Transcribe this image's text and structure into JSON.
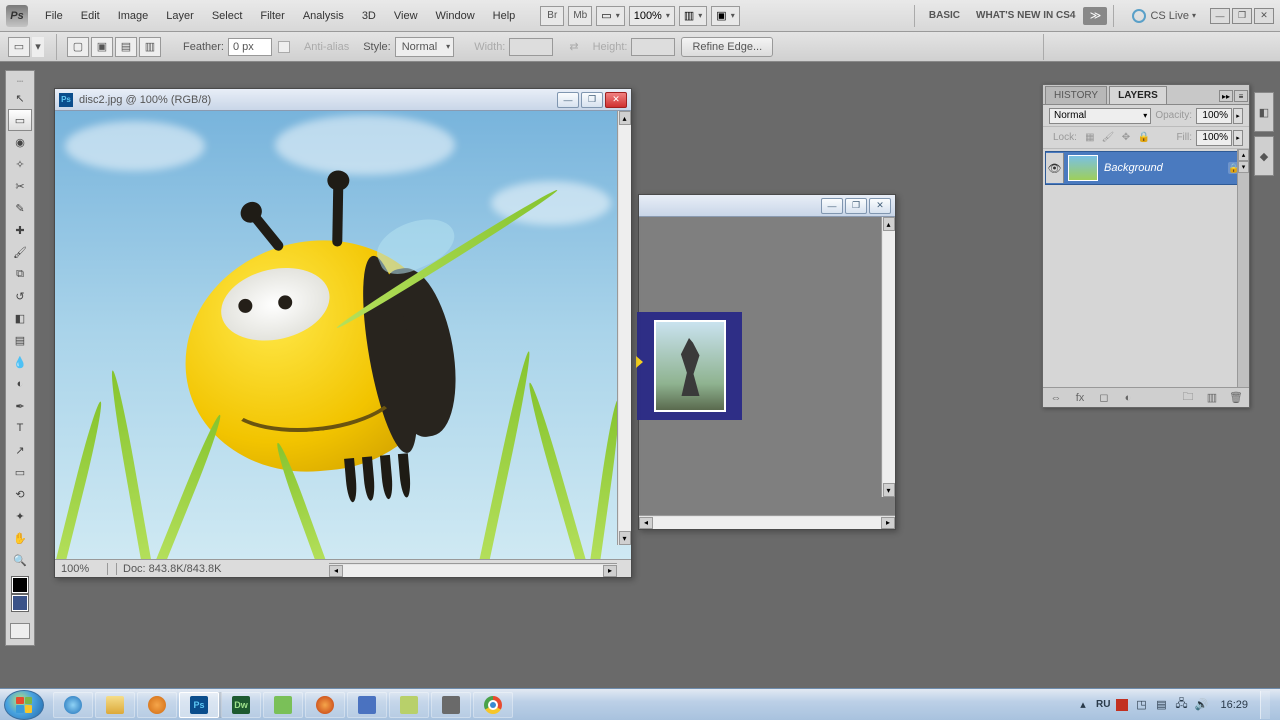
{
  "menubar": {
    "items": [
      "File",
      "Edit",
      "Image",
      "Layer",
      "Select",
      "Filter",
      "Analysis",
      "3D",
      "View",
      "Window",
      "Help"
    ],
    "zoom": "100%",
    "workspace_label_1": "BASIC",
    "workspace_label_2": "WHAT'S NEW IN CS4",
    "cslive": "CS Live"
  },
  "optbar": {
    "feather_label": "Feather:",
    "feather_value": "0 px",
    "antialias": "Anti-alias",
    "style_label": "Style:",
    "style_value": "Normal",
    "width_label": "Width:",
    "height_label": "Height:",
    "refine_btn": "Refine Edge..."
  },
  "tools": [
    "move",
    "marquee",
    "lasso",
    "wand",
    "crop",
    "eyedrop",
    "heal",
    "brush",
    "stamp",
    "history-brush",
    "eraser",
    "gradient",
    "blur",
    "dodge",
    "pen",
    "type",
    "path-select",
    "shape",
    "3d-rotate",
    "3d-orbit",
    "hand",
    "zoom"
  ],
  "doc1": {
    "title": "disc2.jpg @ 100% (RGB/8)",
    "status_zoom": "100%",
    "status_doc": "Doc: 843.8K/843.8K"
  },
  "panel": {
    "tabs": [
      "HISTORY",
      "LAYERS"
    ],
    "blend_mode": "Normal",
    "opacity_label": "Opacity:",
    "opacity_value": "100%",
    "lock_label": "Lock:",
    "fill_label": "Fill:",
    "fill_value": "100%",
    "layer_name": "Background"
  },
  "taskbar": {
    "lang": "RU",
    "time": "16:29"
  }
}
